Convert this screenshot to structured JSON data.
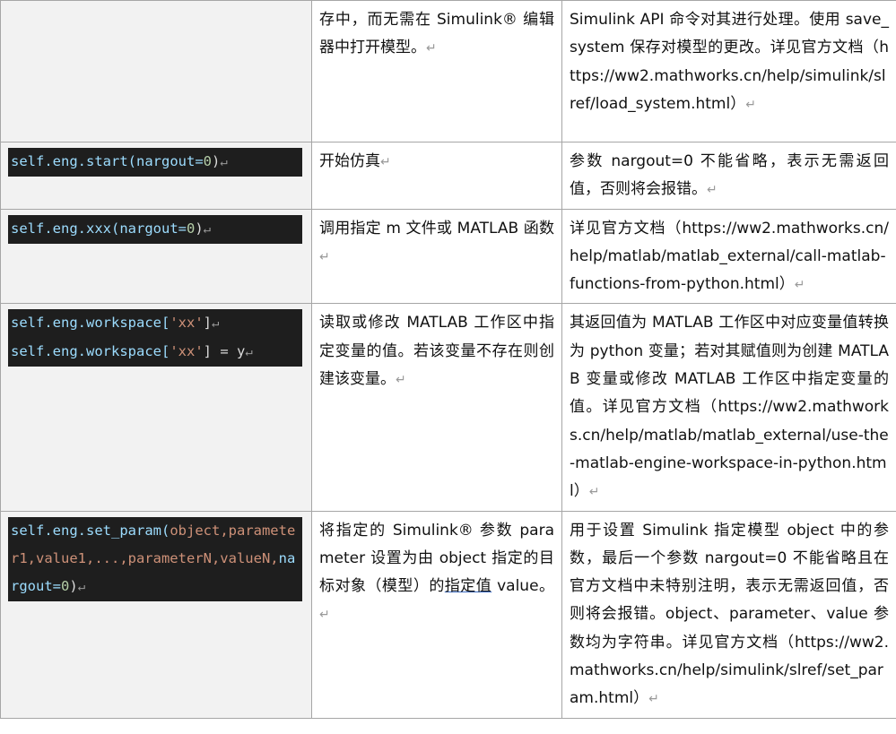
{
  "rows": [
    {
      "col2": "存中，而无需在 Simulink® 编辑器中打开模型。",
      "col3": "Simulink API 命令对其进行处理。使用 save_system 保存对模型的更改。详见官方文档（https://ww2.mathworks.cn/help/simulink/slref/load_system.html）"
    },
    {
      "code": "self.eng.start(nargout=0)",
      "col2": "开始仿真",
      "col3": "参数 nargout=0 不能省略，表示无需返回值，否则将会报错。"
    },
    {
      "code": "self.eng.xxx(nargout=0)",
      "col2": "调用指定 m 文件或 MATLAB 函数",
      "col3": "详见官方文档（https://ww2.mathworks.cn/help/matlab/matlab_external/call-matlab-functions-from-python.html）"
    },
    {
      "code1": "self.eng.workspace['xx']",
      "code2": "self.eng.workspace['xx'] = y",
      "col2": "读取或修改 MATLAB 工作区中指定变量的值。若该变量不存在则创建该变量。",
      "col3": "其返回值为 MATLAB 工作区中对应变量值转换为 python 变量；若对其赋值则为创建 MATLAB 变量或修改 MATLAB 工作区中指定变量的值。详见官方文档（https://ww2.mathworks.cn/help/matlab/matlab_external/use-the-matlab-engine-workspace-in-python.html）"
    },
    {
      "code": "self.eng.set_param(object,parameter1,value1,...,parameterN,valueN,nargout=0)",
      "col2a": "将指定的 Simulink® 参数 parameter 设置为由 object 指定的目标对象（模型）的",
      "col2b": "指定值",
      "col2c": " value。",
      "col3": "用于设置 Simulink 指定模型 object 中的参数，最后一个参数 nargout=0 不能省略且在官方文档中未特别注明，表示无需返回值，否则将会报错。object、parameter、value 参数均为字符串。详见官方文档（https://ww2.mathworks.cn/help/simulink/slref/set_param.html）"
    }
  ],
  "code_tokens": {
    "self_eng": "self.eng.",
    "start": "start(",
    "xxx": "xxx(",
    "nargout": "nargout=",
    "zero": "0",
    "close": ")",
    "workspace": "workspace[",
    "xx": "'xx'",
    "close_bracket": "]",
    "assign": "] = y",
    "set_param": "set_param(",
    "sp_args": "object,parameter1,value1,...,parameterN,valueN,",
    "para_mark": "↵"
  }
}
